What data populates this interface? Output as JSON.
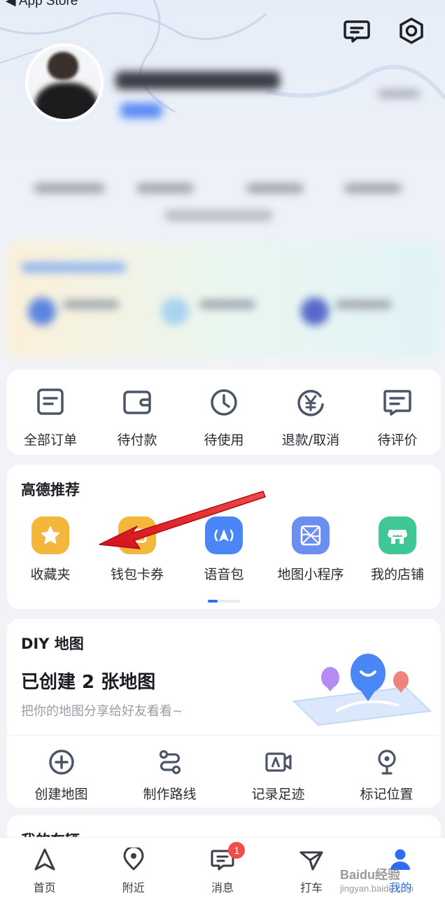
{
  "status_bar": {
    "back_label": "◀ App Store"
  },
  "orders": {
    "items": [
      {
        "label": "全部订单",
        "icon": "order-list-icon"
      },
      {
        "label": "待付款",
        "icon": "wallet-icon"
      },
      {
        "label": "待使用",
        "icon": "clock-icon"
      },
      {
        "label": "退款/取消",
        "icon": "refund-yen-icon"
      },
      {
        "label": "待评价",
        "icon": "comment-icon"
      }
    ]
  },
  "recommend": {
    "title": "高德推荐",
    "items": [
      {
        "label": "收藏夹",
        "icon": "star-icon",
        "color": "#f5b63c"
      },
      {
        "label": "钱包卡券",
        "icon": "wallet-card-icon",
        "color": "#f5b63c"
      },
      {
        "label": "语音包",
        "icon": "voice-pack-icon",
        "color": "#4a86f5"
      },
      {
        "label": "地图小程序",
        "icon": "mini-program-icon",
        "color": "#6b8ff0"
      },
      {
        "label": "我的店铺",
        "icon": "shop-icon",
        "color": "#3fc796"
      }
    ]
  },
  "diy": {
    "title": "DIY 地图",
    "headline": "已创建 2 张地图",
    "subtitle": "把你的地图分享给好友看看~",
    "actions": [
      {
        "label": "创建地图",
        "icon": "plus-circle-icon"
      },
      {
        "label": "制作路线",
        "icon": "route-icon"
      },
      {
        "label": "记录足迹",
        "icon": "video-footprint-icon"
      },
      {
        "label": "标记位置",
        "icon": "pin-icon"
      }
    ]
  },
  "next_section": {
    "title": "我的车辆"
  },
  "tabbar": {
    "items": [
      {
        "label": "首页",
        "icon": "navigation-arrow-icon"
      },
      {
        "label": "附近",
        "icon": "location-pin-icon"
      },
      {
        "label": "消息",
        "icon": "message-icon",
        "badge": "1"
      },
      {
        "label": "打车",
        "icon": "taxi-icon"
      },
      {
        "label": "我的",
        "icon": "person-icon",
        "active": true
      }
    ]
  },
  "watermark": {
    "text": "Baidu经验",
    "sub": "jingyan.baidu.com"
  },
  "colors": {
    "accent": "#2e6cf6",
    "badge": "#f44b4b",
    "arrow": "#e3141b"
  }
}
